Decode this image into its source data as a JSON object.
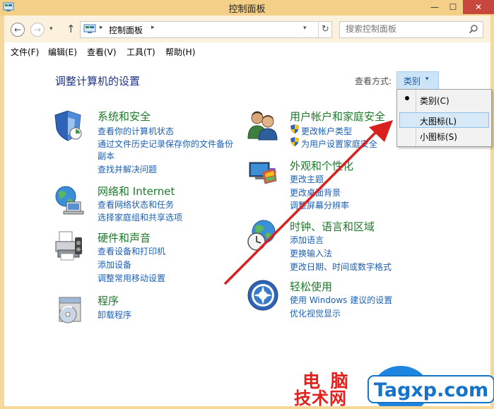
{
  "window": {
    "title": "控制面板"
  },
  "titlebar_buttons": {
    "minimize": "—",
    "maximize": "☐",
    "close": "✕"
  },
  "address": {
    "path": "控制面板",
    "separator": "▸",
    "dropdown": "▾",
    "refresh": "↻"
  },
  "nav": {
    "back": "←",
    "forward": "→",
    "recent": "▾",
    "up": "↑"
  },
  "search": {
    "placeholder": "搜索控制面板"
  },
  "menu": {
    "file": "文件(F)",
    "edit": "编辑(E)",
    "view": "查看(V)",
    "tools": "工具(T)",
    "help": "帮助(H)"
  },
  "content": {
    "heading": "调整计算机的设置",
    "view_by_label": "查看方式:",
    "view_by_value": "类别",
    "view_by_arrow": "▾"
  },
  "categories": {
    "system": {
      "title": "系统和安全",
      "links": [
        "查看你的计算机状态",
        "通过文件历史记录保存你的文件备份",
        "副本",
        "查找并解决问题"
      ],
      "icon": "shield-icon"
    },
    "network": {
      "title": "网络和 Internet",
      "links": [
        "查看网络状态和任务",
        "选择家庭组和共享选项"
      ],
      "icon": "globe-network-icon"
    },
    "hardware": {
      "title": "硬件和声音",
      "links": [
        "查看设备和打印机",
        "添加设备",
        "调整常用移动设置"
      ],
      "icon": "printer-icon"
    },
    "programs": {
      "title": "程序",
      "links": [
        "卸载程序"
      ],
      "icon": "programs-disc-icon"
    },
    "users": {
      "title": "用户帐户和家庭安全",
      "links": [
        "更改帐户类型",
        "为用户设置家庭安全"
      ],
      "icon": "users-icon"
    },
    "appearance": {
      "title": "外观和个性化",
      "links": [
        "更改主题",
        "更改桌面背景",
        "调整屏幕分辨率"
      ],
      "icon": "appearance-monitor-icon"
    },
    "clock": {
      "title": "时钟、语言和区域",
      "links": [
        "添加语言",
        "更换输入法",
        "更改日期、时间或数字格式"
      ],
      "icon": "clock-globe-icon"
    },
    "ease": {
      "title": "轻松使用",
      "links": [
        "使用 Windows 建议的设置",
        "优化视觉显示"
      ],
      "icon": "ease-of-access-icon"
    }
  },
  "dropdown": {
    "items": [
      "类别(C)",
      "大图标(L)",
      "小图标(S)"
    ],
    "selected": "类别(C)",
    "hovered": "大图标(L)"
  },
  "watermark": {
    "line1": "电 脑",
    "line2": "技术网",
    "logo": "Tagxp.com"
  },
  "colors": {
    "title_bar": "#f4cf88",
    "category_title": "#1d7a2a",
    "link": "#1c5fb5",
    "heading": "#1e3287",
    "arrow": "#d9201f",
    "watermark_red": "#e3211c",
    "watermark_logo": "#1574c9"
  }
}
